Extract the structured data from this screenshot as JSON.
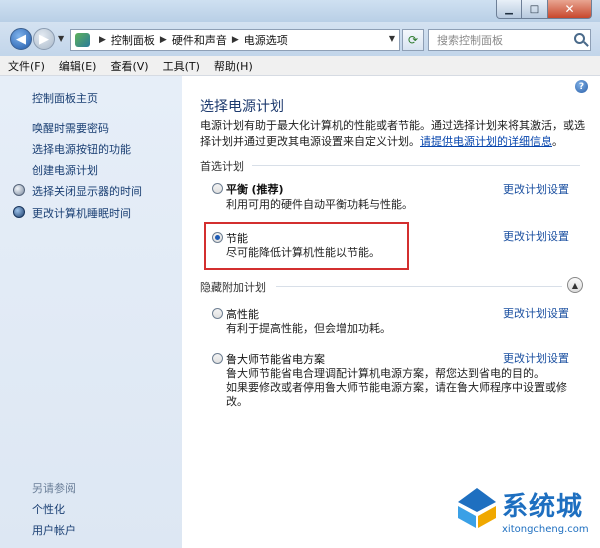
{
  "address": {
    "crumbs": [
      "控制面板",
      "硬件和声音",
      "电源选项"
    ],
    "search_placeholder": "搜索控制面板"
  },
  "menu": [
    "文件(F)",
    "编辑(E)",
    "查看(V)",
    "工具(T)",
    "帮助(H)"
  ],
  "sidebar": {
    "home": "控制面板主页",
    "links": [
      "唤醒时需要密码",
      "选择电源按钮的功能",
      "创建电源计划",
      "选择关闭显示器的时间",
      "更改计算机睡眠时间"
    ],
    "see_also": "另请参阅",
    "see_also_links": [
      "个性化",
      "用户帐户"
    ]
  },
  "main": {
    "title": "选择电源计划",
    "description": "电源计划有助于最大化计算机的性能或者节能。通过选择计划来将其激活，或选择计划并通过更改其电源设置来自定义计划。",
    "description_link": "请提供电源计划的详细信息",
    "preferred_header": "首选计划",
    "hidden_header": "隐藏附加计划",
    "change_link": "更改计划设置",
    "plans": [
      {
        "name": "平衡",
        "suffix": "(推荐)",
        "desc": "利用可用的硬件自动平衡功耗与性能。",
        "selected": false
      },
      {
        "name": "节能",
        "suffix": "",
        "desc": "尽可能降低计算机性能以节能。",
        "selected": true
      },
      {
        "name": "高性能",
        "suffix": "",
        "desc": "有利于提高性能，但会增加功耗。",
        "selected": false
      },
      {
        "name": "鲁大师节能省电方案",
        "suffix": "",
        "desc_lines": [
          "鲁大师节能省电合理调配计算机电源方案，帮您达到省电的目的。",
          "如果要修改或者停用鲁大师节能电源方案，请在鲁大师程序中设置或修",
          "改。"
        ],
        "selected": false
      }
    ]
  },
  "watermark": {
    "title": "系统城",
    "url": "xitongcheng.com"
  }
}
